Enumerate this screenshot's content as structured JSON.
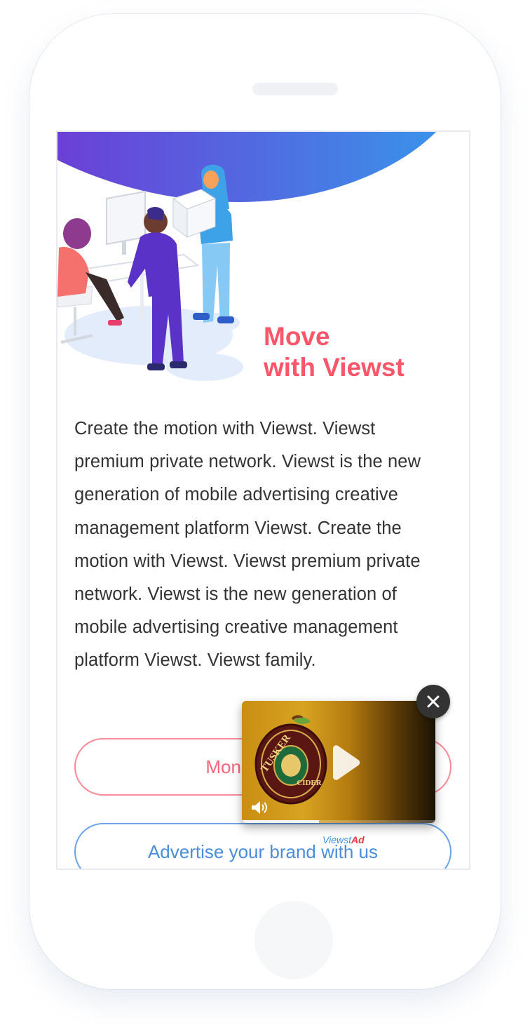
{
  "hero": {
    "headline_line1": "Move",
    "headline_line2": "with Viewst"
  },
  "body": {
    "paragraph": "Create the motion with Viewst. Viewst premium private network. Viewst is the new generation of mobile advertising creative management platform Viewst. Create the motion with Viewst. Viewst premium private network. Viewst is the new generation of mobile advertising creative management platform Viewst. Viewst family."
  },
  "buttons": {
    "monetize_label": "Monetize your",
    "advertise_label": "Advertise your brand with us"
  },
  "ad": {
    "brand_top": "TUSKER",
    "brand_bottom": "CIDER",
    "label_part1": "Viewst",
    "label_part2": "Ad",
    "progress": 0.4,
    "close_glyph": "✕",
    "icons": [
      "play-icon",
      "volume-icon",
      "close-icon"
    ]
  },
  "colors": {
    "headline": "#f9566a",
    "monetize_border": "#f98a96",
    "advertise_border": "#6aa4e6",
    "gradient_start": "#6b3fd6",
    "gradient_end": "#3a92ea"
  }
}
